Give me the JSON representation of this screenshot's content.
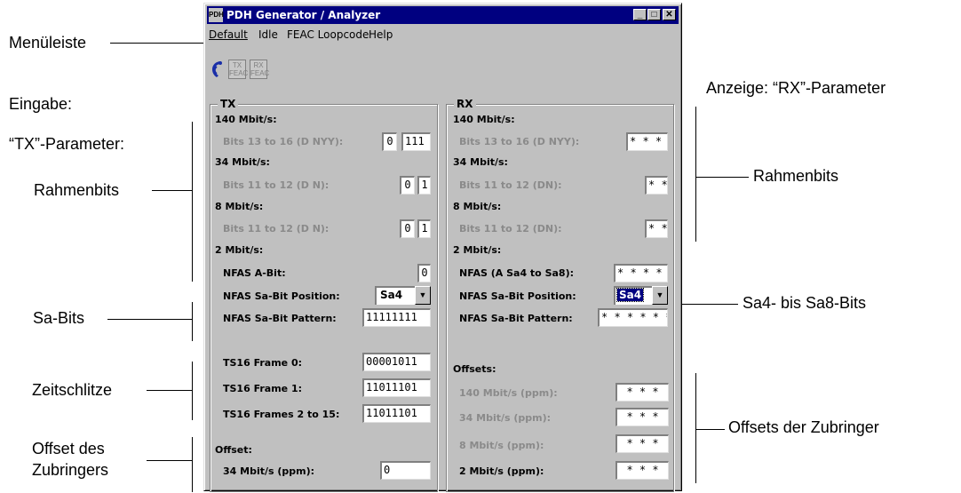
{
  "annotations": {
    "menubar": "Menüleiste",
    "input_line1": "Eingabe:",
    "input_line2": "“TX”-Parameter:",
    "tx_frame_bits": "Rahmenbits",
    "tx_sa_bits": "Sa-Bits",
    "tx_timeslots": "Zeitschlitze",
    "tx_offset_line1": "Offset des",
    "tx_offset_line2": "Zubringers",
    "rx_display": "Anzeige: “RX”-Parameter",
    "rx_frame_bits": "Rahmenbits",
    "rx_sa_bits": "Sa4- bis Sa8-Bits",
    "rx_offsets": "Offsets der Zubringer"
  },
  "window": {
    "title": "PDH Generator / Analyzer",
    "icon_text": "PDH",
    "min_glyph": "_",
    "max_glyph": "□",
    "close_glyph": "✕"
  },
  "menu": [
    "Default",
    "Idle",
    "FEAC Loopcode",
    "Help"
  ],
  "toolbar": {
    "tx_feac_line1": "TX",
    "tx_feac_line2": "FEAC",
    "rx_feac_line1": "RX",
    "rx_feac_line2": "FEAC"
  },
  "tx": {
    "title": "TX",
    "h140": "140 Mbit/s:",
    "bits13_16_label": "Bits 13 to 16 (D NYY):",
    "bits13_16_d": "0",
    "bits13_16_nyy": "111",
    "h34": "34 Mbit/s:",
    "bits34_label": "Bits 11 to 12 (D N):",
    "bits34_d": "0",
    "bits34_n": "1",
    "h8": "8 Mbit/s:",
    "bits8_label": "Bits 11 to 12 (D N):",
    "bits8_d": "0",
    "bits8_n": "1",
    "h2": "2 Mbit/s:",
    "nfas_a_label": "NFAS A-Bit:",
    "nfas_a_value": "0",
    "sa_pos_label": "NFAS Sa-Bit Position:",
    "sa_pos_value": "Sa4",
    "sa_pat_label": "NFAS Sa-Bit Pattern:",
    "sa_pat_value": "11111111",
    "ts16_f0_label": "TS16 Frame 0:",
    "ts16_f0_value": "00001011",
    "ts16_f1_label": "TS16 Frame 1:",
    "ts16_f1_value": "11011101",
    "ts16_f2_label": "TS16 Frames 2 to 15:",
    "ts16_f2_value": "11011101",
    "offset_heading": "Offset:",
    "offset34_label": "34 Mbit/s (ppm):",
    "offset34_value": "0"
  },
  "rx": {
    "title": "RX",
    "h140": "140 Mbit/s:",
    "bits13_16_label": "Bits 13 to 16 (D NYY):",
    "bits13_16_value": "* * * *",
    "h34": "34 Mbit/s:",
    "bits34_label": "Bits 11 to 12 (DN):",
    "bits34_value": "* *",
    "h8": "8 Mbit/s:",
    "bits8_label": "Bits 11 to 12 (DN):",
    "bits8_value": "* *",
    "h2": "2 Mbit/s:",
    "nfas_label": "NFAS (A Sa4 to Sa8):",
    "nfas_value": "* * * * *",
    "sa_pos_label": "NFAS Sa-Bit Position:",
    "sa_pos_value": "Sa4",
    "sa_pat_label": "NFAS Sa-Bit Pattern:",
    "sa_pat_value": "* * * * * * * *",
    "offsets_heading": "Offsets:",
    "off140_label": "140 Mbit/s (ppm):",
    "off140_value": "* * *",
    "off34_label": "34 Mbit/s (ppm):",
    "off34_value": "* * *",
    "off8_label": "8 Mbit/s (ppm):",
    "off8_value": "* * *",
    "off2_label": "2 Mbit/s (ppm):",
    "off2_value": "* * *"
  },
  "colors": {
    "titlebar": "#000080",
    "face": "#c0c0c0",
    "disabled_text": "#8a8a8a",
    "selection": "#000080"
  }
}
